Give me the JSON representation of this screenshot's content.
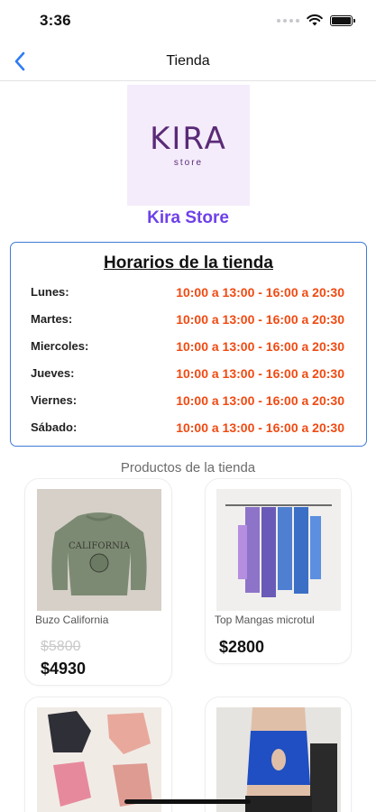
{
  "status_bar": {
    "time": "3:36"
  },
  "nav": {
    "title": "Tienda"
  },
  "store": {
    "logo_word": "KIRA",
    "logo_sub": "store",
    "name": "Kira Store"
  },
  "hours": {
    "title": "Horarios de la tienda",
    "rows": [
      {
        "day": "Lunes:",
        "time": "10:00 a 13:00 - 16:00 a 20:30"
      },
      {
        "day": "Martes:",
        "time": "10:00 a 13:00 - 16:00 a 20:30"
      },
      {
        "day": "Miercoles:",
        "time": "10:00 a 13:00 - 16:00 a 20:30"
      },
      {
        "day": "Jueves:",
        "time": "10:00 a 13:00 - 16:00 a 20:30"
      },
      {
        "day": "Viernes:",
        "time": "10:00 a 13:00 - 16:00 a 20:30"
      },
      {
        "day": "Sábado:",
        "time": "10:00 a 13:00 - 16:00 a 20:30"
      }
    ]
  },
  "products": {
    "heading": "Productos de la tienda",
    "items": [
      {
        "name": "Buzo California",
        "old_price": "$5800",
        "price": "$4930"
      },
      {
        "name": "Top Mangas microtul",
        "old_price": "",
        "price": "$2800"
      },
      {
        "name": "",
        "old_price": "",
        "price": ""
      },
      {
        "name": "",
        "old_price": "",
        "price": ""
      }
    ]
  },
  "colors": {
    "accent": "#6e40ea",
    "hours_time": "#f04a12",
    "card_border": "#3e7bd6",
    "logo_bg": "#f4ecfb"
  }
}
